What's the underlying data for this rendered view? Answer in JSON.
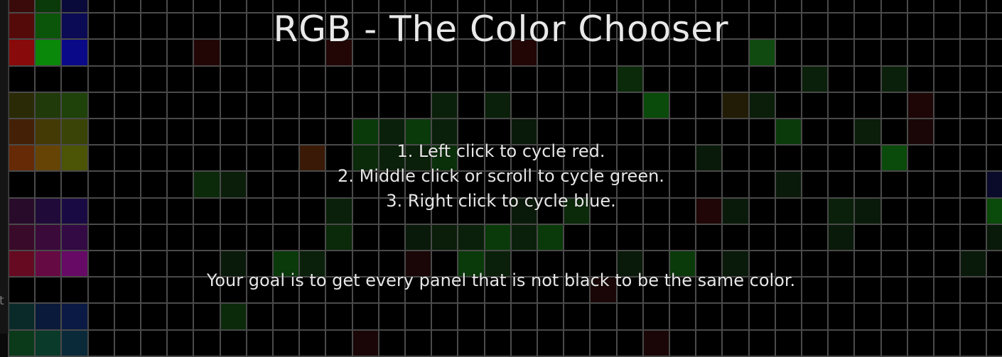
{
  "title": "RGB - The Color Chooser",
  "instructions": [
    "1. Left click to cycle red.",
    "2. Middle click or scroll to cycle green.",
    "3. Right click to cycle blue."
  ],
  "goal": "Your goal is to get every panel that is not black to be the same color.",
  "edge_glyph": "t",
  "colors": {
    "background": "#000000",
    "grid_line": "#4a4a4a",
    "text": "#e6e6e6"
  },
  "board": {
    "rows": 14,
    "cols": 38,
    "default_color": "#000000",
    "panels": [
      {
        "r": 0,
        "c": 0,
        "color": "#3a0a0a"
      },
      {
        "r": 0,
        "c": 1,
        "color": "#0a3a0a"
      },
      {
        "r": 0,
        "c": 2,
        "color": "#0a0a3a"
      },
      {
        "r": 1,
        "c": 0,
        "color": "#550a0a"
      },
      {
        "r": 1,
        "c": 1,
        "color": "#0a550a"
      },
      {
        "r": 1,
        "c": 2,
        "color": "#0a0a55"
      },
      {
        "r": 2,
        "c": 0,
        "color": "#880a0a"
      },
      {
        "r": 2,
        "c": 1,
        "color": "#0a880a"
      },
      {
        "r": 2,
        "c": 2,
        "color": "#0a0a88"
      },
      {
        "r": 2,
        "c": 7,
        "color": "#220606"
      },
      {
        "r": 2,
        "c": 12,
        "color": "#220606"
      },
      {
        "r": 2,
        "c": 19,
        "color": "#220606"
      },
      {
        "r": 2,
        "c": 28,
        "color": "#104a10"
      },
      {
        "r": 3,
        "c": 23,
        "color": "#0a2a0a"
      },
      {
        "r": 3,
        "c": 30,
        "color": "#0a200a"
      },
      {
        "r": 3,
        "c": 33,
        "color": "#0a200a"
      },
      {
        "r": 4,
        "c": 0,
        "color": "#2a2a06"
      },
      {
        "r": 4,
        "c": 1,
        "color": "#203a0a"
      },
      {
        "r": 4,
        "c": 2,
        "color": "#1e420a"
      },
      {
        "r": 4,
        "c": 16,
        "color": "#0a200a"
      },
      {
        "r": 4,
        "c": 18,
        "color": "#0a200a"
      },
      {
        "r": 4,
        "c": 24,
        "color": "#0a4a0a"
      },
      {
        "r": 4,
        "c": 27,
        "color": "#221c06"
      },
      {
        "r": 4,
        "c": 28,
        "color": "#0a1e0a"
      },
      {
        "r": 4,
        "c": 34,
        "color": "#1e0606"
      },
      {
        "r": 5,
        "c": 0,
        "color": "#442006"
      },
      {
        "r": 5,
        "c": 1,
        "color": "#443a06"
      },
      {
        "r": 5,
        "c": 2,
        "color": "#3a4406"
      },
      {
        "r": 5,
        "c": 13,
        "color": "#0a3a0a"
      },
      {
        "r": 5,
        "c": 14,
        "color": "#0a200a"
      },
      {
        "r": 5,
        "c": 15,
        "color": "#0a3a0a"
      },
      {
        "r": 5,
        "c": 16,
        "color": "#0a200a"
      },
      {
        "r": 5,
        "c": 19,
        "color": "#0a1a0a"
      },
      {
        "r": 5,
        "c": 29,
        "color": "#0a3a0a"
      },
      {
        "r": 5,
        "c": 32,
        "color": "#0a1e0a"
      },
      {
        "r": 5,
        "c": 34,
        "color": "#1a0606"
      },
      {
        "r": 6,
        "c": 0,
        "color": "#662a06"
      },
      {
        "r": 6,
        "c": 1,
        "color": "#664406"
      },
      {
        "r": 6,
        "c": 2,
        "color": "#4c5406"
      },
      {
        "r": 6,
        "c": 11,
        "color": "#3a1a06"
      },
      {
        "r": 6,
        "c": 13,
        "color": "#0a2a0a"
      },
      {
        "r": 6,
        "c": 14,
        "color": "#0a200a"
      },
      {
        "r": 6,
        "c": 15,
        "color": "#0a200a"
      },
      {
        "r": 6,
        "c": 16,
        "color": "#0a300a"
      },
      {
        "r": 6,
        "c": 26,
        "color": "#0a1a0a"
      },
      {
        "r": 6,
        "c": 33,
        "color": "#0a4a0a"
      },
      {
        "r": 7,
        "c": 7,
        "color": "#0a2a0a"
      },
      {
        "r": 7,
        "c": 8,
        "color": "#0a1e0a"
      },
      {
        "r": 7,
        "c": 29,
        "color": "#0a1a0a"
      },
      {
        "r": 7,
        "c": 37,
        "color": "#0a0a2a"
      },
      {
        "r": 8,
        "c": 0,
        "color": "#280a2a"
      },
      {
        "r": 8,
        "c": 1,
        "color": "#200a3a"
      },
      {
        "r": 8,
        "c": 2,
        "color": "#1a0a44"
      },
      {
        "r": 8,
        "c": 12,
        "color": "#0a200a"
      },
      {
        "r": 8,
        "c": 19,
        "color": "#0a1a0a"
      },
      {
        "r": 8,
        "c": 21,
        "color": "#0a2a0a"
      },
      {
        "r": 8,
        "c": 26,
        "color": "#200606"
      },
      {
        "r": 8,
        "c": 27,
        "color": "#0a1a0a"
      },
      {
        "r": 8,
        "c": 31,
        "color": "#0a200a"
      },
      {
        "r": 8,
        "c": 32,
        "color": "#0a1a0a"
      },
      {
        "r": 8,
        "c": 37,
        "color": "#0a4a0a"
      },
      {
        "r": 9,
        "c": 0,
        "color": "#3a0a2a"
      },
      {
        "r": 9,
        "c": 1,
        "color": "#3a0a3a"
      },
      {
        "r": 9,
        "c": 2,
        "color": "#330a44"
      },
      {
        "r": 9,
        "c": 12,
        "color": "#0a2a0a"
      },
      {
        "r": 9,
        "c": 15,
        "color": "#0a1a0a"
      },
      {
        "r": 9,
        "c": 16,
        "color": "#0a1e0a"
      },
      {
        "r": 9,
        "c": 17,
        "color": "#0a200a"
      },
      {
        "r": 9,
        "c": 18,
        "color": "#0a3a0a"
      },
      {
        "r": 9,
        "c": 19,
        "color": "#0a200a"
      },
      {
        "r": 9,
        "c": 20,
        "color": "#0a3a0a"
      },
      {
        "r": 9,
        "c": 31,
        "color": "#0a1a0a"
      },
      {
        "r": 9,
        "c": 37,
        "color": "#0a1a0a"
      },
      {
        "r": 10,
        "c": 0,
        "color": "#660a22"
      },
      {
        "r": 10,
        "c": 1,
        "color": "#660a44"
      },
      {
        "r": 10,
        "c": 2,
        "color": "#660a66"
      },
      {
        "r": 10,
        "c": 8,
        "color": "#0a1a0a"
      },
      {
        "r": 10,
        "c": 10,
        "color": "#0a3a0a"
      },
      {
        "r": 10,
        "c": 11,
        "color": "#0a200a"
      },
      {
        "r": 10,
        "c": 15,
        "color": "#1a0606"
      },
      {
        "r": 10,
        "c": 17,
        "color": "#0a3a0a"
      },
      {
        "r": 10,
        "c": 18,
        "color": "#0a200a"
      },
      {
        "r": 10,
        "c": 23,
        "color": "#0a1a0a"
      },
      {
        "r": 10,
        "c": 25,
        "color": "#0a3a0a"
      },
      {
        "r": 10,
        "c": 27,
        "color": "#0a1a0a"
      },
      {
        "r": 10,
        "c": 36,
        "color": "#0a1a0a"
      },
      {
        "r": 11,
        "c": 22,
        "color": "#1a0606"
      },
      {
        "r": 12,
        "c": 0,
        "color": "#0a2a2a"
      },
      {
        "r": 12,
        "c": 1,
        "color": "#0a1a3a"
      },
      {
        "r": 12,
        "c": 2,
        "color": "#0a1a44"
      },
      {
        "r": 12,
        "c": 8,
        "color": "#0a2a0a"
      },
      {
        "r": 13,
        "c": 0,
        "color": "#0a3a1a"
      },
      {
        "r": 13,
        "c": 1,
        "color": "#0a3a2a"
      },
      {
        "r": 13,
        "c": 2,
        "color": "#0a2a3a"
      },
      {
        "r": 13,
        "c": 13,
        "color": "#1a0606"
      },
      {
        "r": 13,
        "c": 24,
        "color": "#1a0606"
      }
    ]
  }
}
